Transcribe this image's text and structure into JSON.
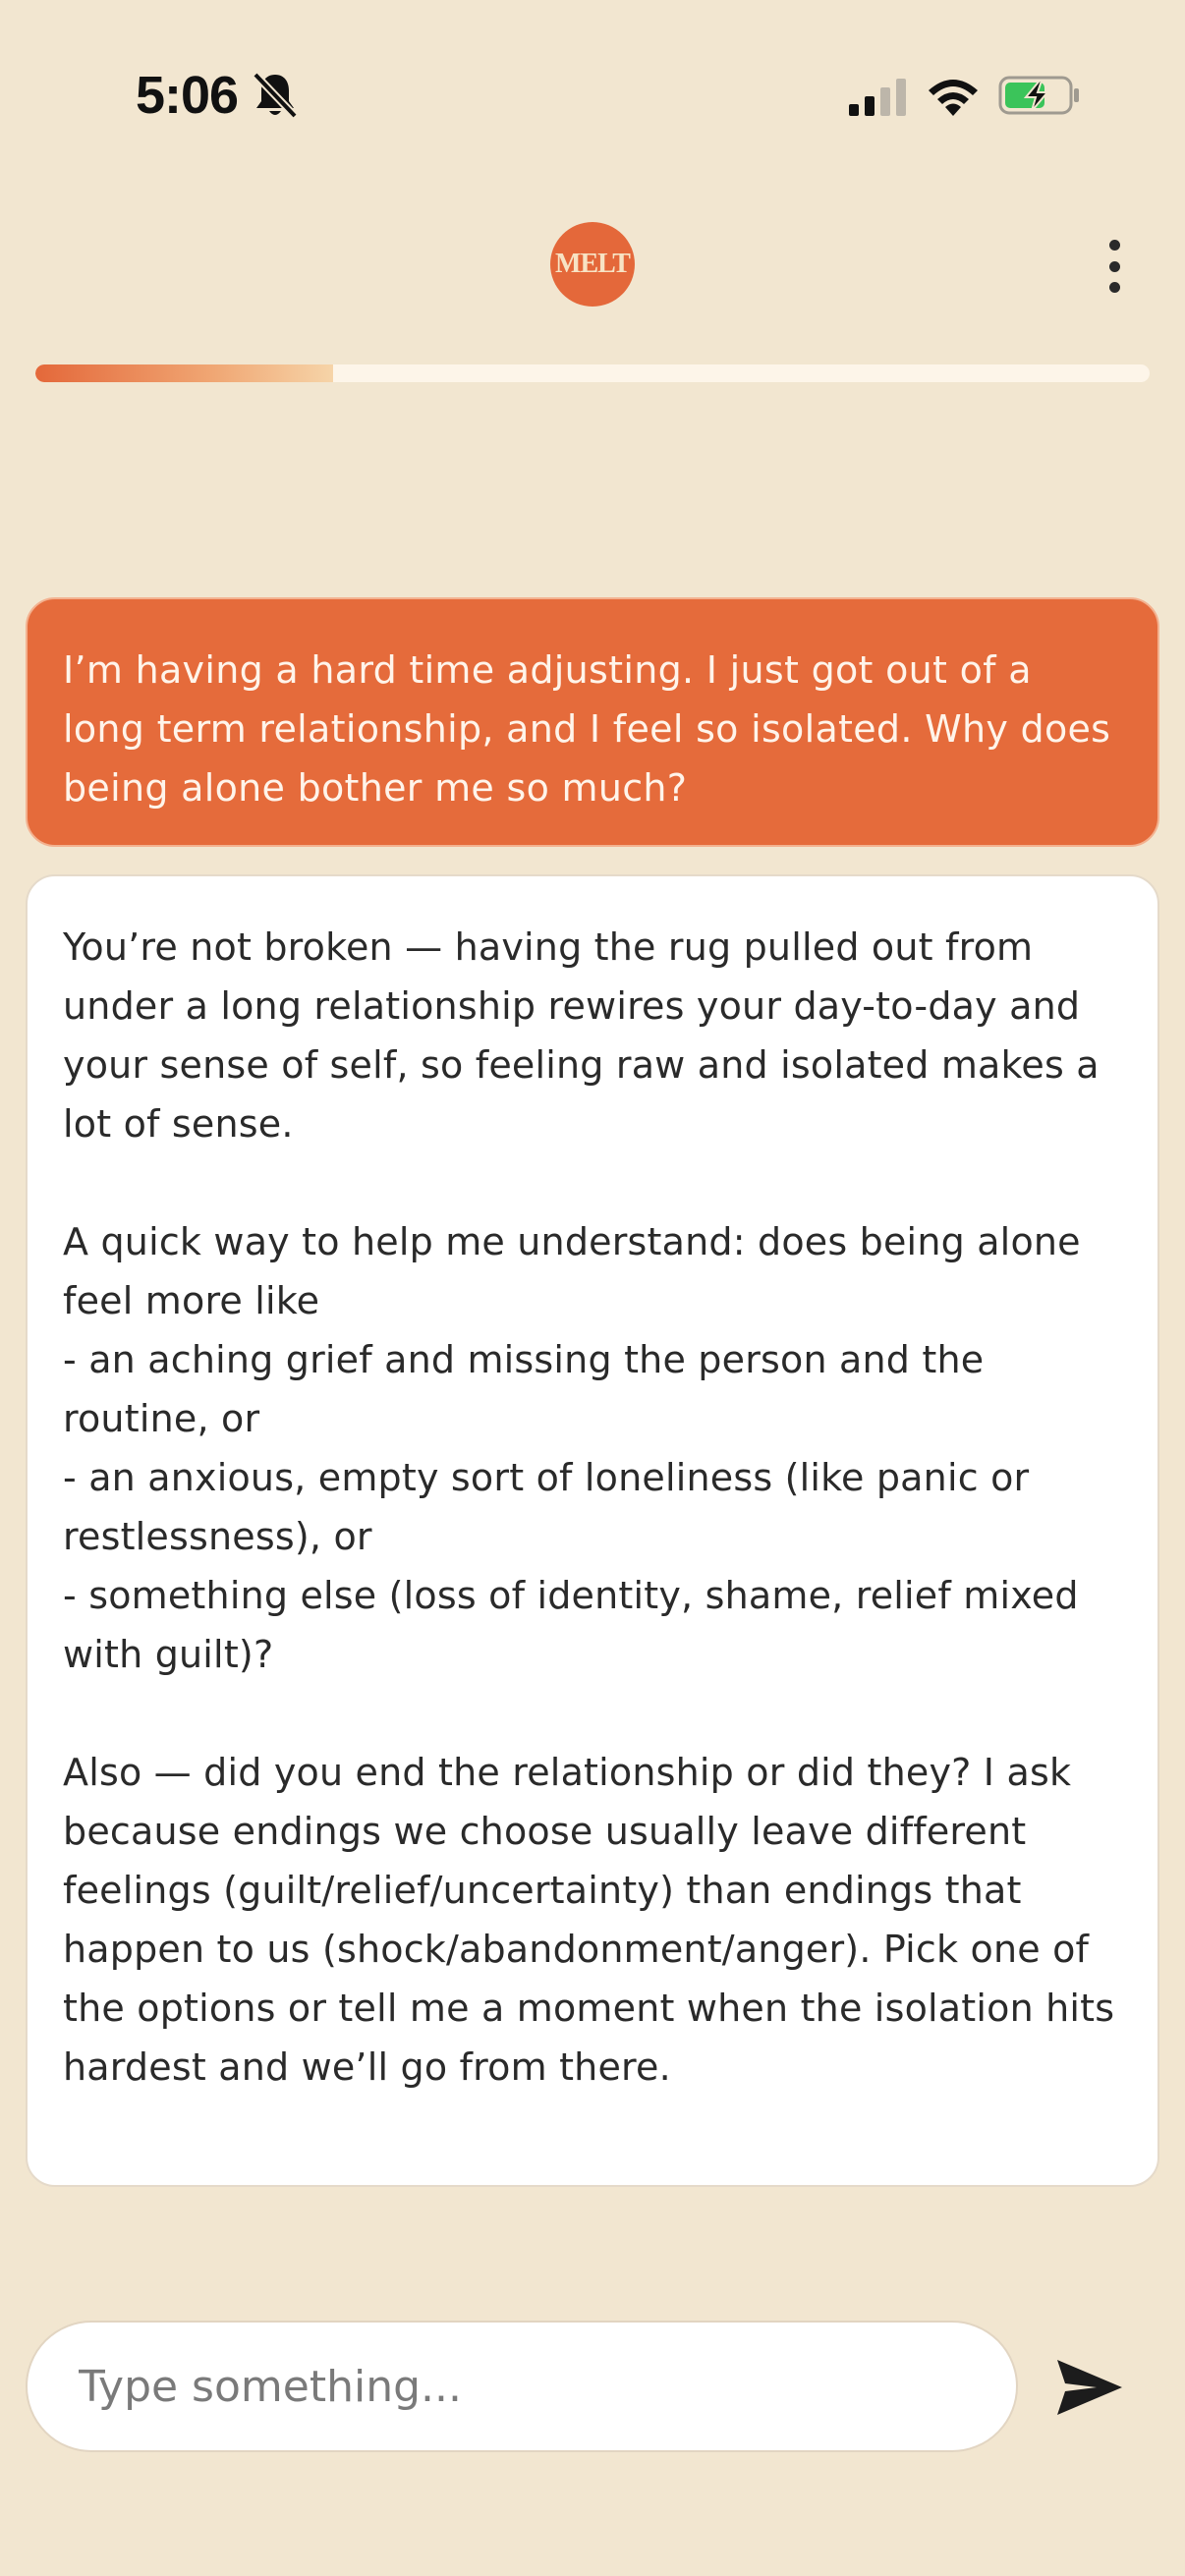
{
  "status_bar": {
    "time": "5:06"
  },
  "header": {
    "logo_text": "MELT",
    "progress_fraction": 0.267
  },
  "messages": {
    "user": "I’m having a hard time adjusting. I just got out of a long term relationship, and I feel so isolated. Why does being alone bother me so much?",
    "assistant": "You’re not broken — having the rug pulled out from under a long relationship rewires your day-to-day and your sense of self, so feeling raw and isolated makes a lot of sense.\n\nA quick way to help me understand: does being alone feel more like\n- an aching grief and missing the person and the routine, or\n- an anxious, empty sort of loneliness (like panic or restlessness), or\n- something else (loss of identity, shame, relief mixed with guilt)?\n\nAlso — did you end the relationship or did they? I ask because endings we choose usually leave different feelings (guilt/relief/uncertainty) than endings that happen to us (shock/abandonment/anger). Pick one of the options or tell me a moment when the isolation hits hardest and we’ll go from there."
  },
  "composer": {
    "placeholder": "Type something...",
    "value": ""
  },
  "icons": {
    "mute": "bell-slash-icon",
    "signal": "cellular-signal-icon",
    "wifi": "wifi-icon",
    "battery": "battery-charging-icon",
    "menu": "more-vertical-icon",
    "send": "send-icon"
  },
  "colors": {
    "background": "#F2E6D0",
    "accent": "#E56B3B",
    "bubble_bot": "#FFFFFF",
    "battery_fill": "#3BC45A"
  }
}
